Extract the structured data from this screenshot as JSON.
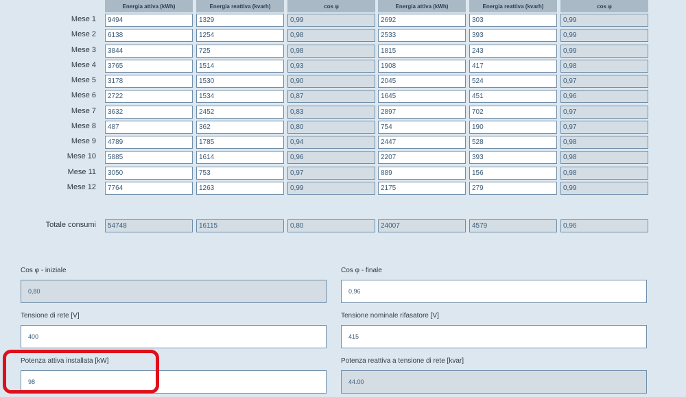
{
  "headers": [
    "Energia attiva (kWh)",
    "Energia reattiva (kvarh)",
    "cos φ",
    "Energia attiva (kWh)",
    "Energia reattiva (kvarh)",
    "cos φ"
  ],
  "rows": [
    {
      "label": "Mese 1",
      "values": [
        "9494",
        "1329",
        "0,99",
        "2692",
        "303",
        "0,99"
      ]
    },
    {
      "label": "Mese 2",
      "values": [
        "6138",
        "1254",
        "0,98",
        "2533",
        "393",
        "0,99"
      ]
    },
    {
      "label": "Mese 3",
      "values": [
        "3844",
        "725",
        "0,98",
        "1815",
        "243",
        "0,99"
      ]
    },
    {
      "label": "Mese 4",
      "values": [
        "3765",
        "1514",
        "0,93",
        "1908",
        "417",
        "0,98"
      ]
    },
    {
      "label": "Mese 5",
      "values": [
        "3178",
        "1530",
        "0,90",
        "2045",
        "524",
        "0,97"
      ]
    },
    {
      "label": "Mese 6",
      "values": [
        "2722",
        "1534",
        "0,87",
        "1645",
        "451",
        "0,96"
      ]
    },
    {
      "label": "Mese 7",
      "values": [
        "3632",
        "2452",
        "0,83",
        "2897",
        "702",
        "0,97"
      ]
    },
    {
      "label": "Mese 8",
      "values": [
        "487",
        "362",
        "0,80",
        "754",
        "190",
        "0,97"
      ]
    },
    {
      "label": "Mese 9",
      "values": [
        "4789",
        "1785",
        "0,94",
        "2447",
        "528",
        "0,98"
      ]
    },
    {
      "label": "Mese 10",
      "values": [
        "5885",
        "1614",
        "0,96",
        "2207",
        "393",
        "0,98"
      ]
    },
    {
      "label": "Mese 11",
      "values": [
        "3050",
        "753",
        "0,97",
        "889",
        "156",
        "0,98"
      ]
    },
    {
      "label": "Mese 12",
      "values": [
        "7764",
        "1263",
        "0,99",
        "2175",
        "279",
        "0,99"
      ]
    }
  ],
  "totals": {
    "label": "Totale consumi",
    "values": [
      "54748",
      "16115",
      "0,80",
      "24007",
      "4579",
      "0,96"
    ]
  },
  "form": {
    "cos_iniziale": {
      "label": "Cos φ - iniziale",
      "value": "0,80"
    },
    "cos_finale": {
      "label": "Cos φ - finale",
      "value": "0,96"
    },
    "tensione_rete": {
      "label": "Tensione di rete [V]",
      "value": "400"
    },
    "tensione_rifasatore": {
      "label": "Tensione nominale rifasatore [V]",
      "value": "415"
    },
    "potenza_attiva": {
      "label": "Potenza attiva installata [kW]",
      "value": "98"
    },
    "potenza_reattiva": {
      "label": "Potenza reattiva a tensione di rete [kvar]",
      "value": "44.00"
    }
  },
  "colors": {
    "highlight": "#e0101a",
    "background": "#dde7ef",
    "header": "#a9b9c6"
  }
}
